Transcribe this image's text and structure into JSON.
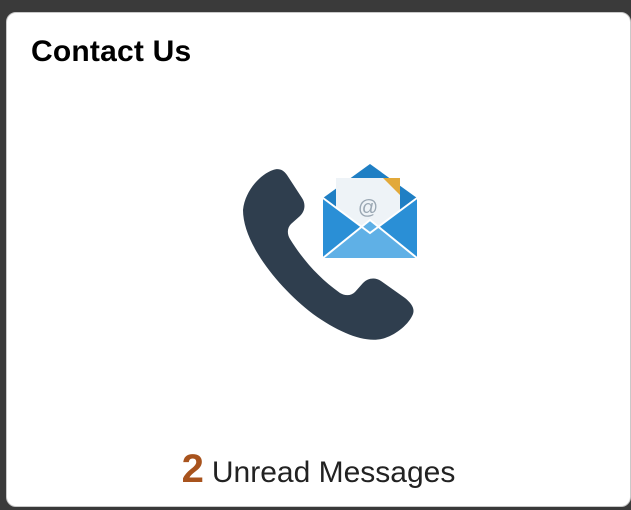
{
  "tile": {
    "title": "Contact Us",
    "icon": "phone-with-envelope-icon",
    "badge": {
      "count": "2",
      "label": "Unread Messages"
    }
  },
  "colors": {
    "count": "#a8531d",
    "phone": "#2f3e4e",
    "envelope": "#1f7fc4",
    "envelope_light": "#5fb0e6"
  }
}
